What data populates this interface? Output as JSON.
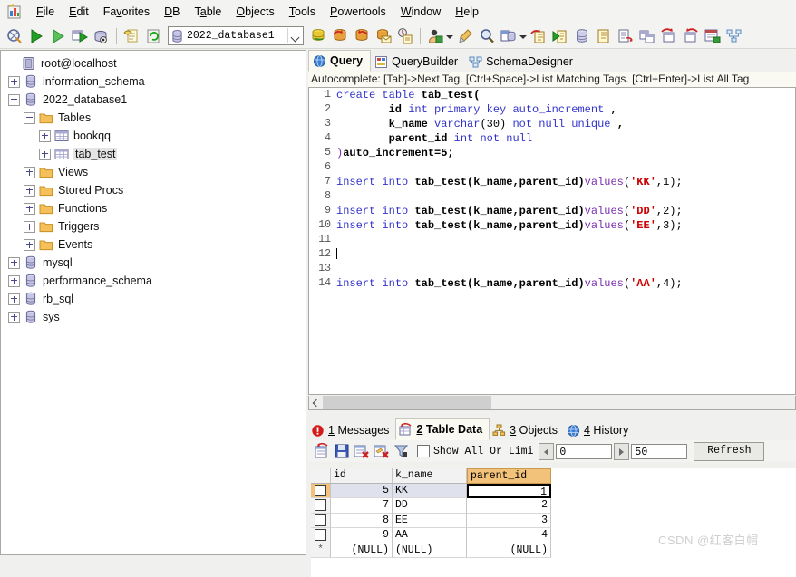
{
  "menubar": {
    "app_icon": "sqlyog-app-icon",
    "items": [
      {
        "label": "File",
        "accel": "F"
      },
      {
        "label": "Edit",
        "accel": "E"
      },
      {
        "label": "Favorites",
        "accel": "v"
      },
      {
        "label": "DB",
        "accel": "D"
      },
      {
        "label": "Table",
        "accel": "a"
      },
      {
        "label": "Objects",
        "accel": "O"
      },
      {
        "label": "Tools",
        "accel": "T"
      },
      {
        "label": "Powertools",
        "accel": "P"
      },
      {
        "label": "Window",
        "accel": "W"
      },
      {
        "label": "Help",
        "accel": "H"
      }
    ]
  },
  "toolbar": {
    "database_selector": {
      "value": "2022_database1",
      "icon": "database-icon"
    },
    "icons": [
      "new-connection-icon",
      "execute-query-icon",
      "execute-current-query-icon",
      "execute-query-to-grid-icon",
      "stop-query-icon",
      "open-file-icon",
      "refresh-icon",
      "import-external-data-icon",
      "restore-from-sql-dump-icon",
      "backup-database-icon",
      "export-as-email-icon",
      "schedule-backup-icon",
      "user-manager-icon",
      "flush-icon",
      "find-icon",
      "database-sync-icon",
      "copy-database-icon",
      "run-script-icon",
      "copy-table-icon",
      "paste-icon",
      "query-to-file-icon",
      "new-table-icon",
      "alter-table-icon",
      "truncate-table-icon",
      "table-diagnostics-icon",
      "schema-designer-icon"
    ]
  },
  "sidebar": {
    "nodes": [
      {
        "label": "root@localhost",
        "icon": "server-icon",
        "indent": 0,
        "toggle": "none",
        "selected": false
      },
      {
        "label": "information_schema",
        "icon": "database-icon",
        "indent": 0,
        "toggle": "plus",
        "selected": false
      },
      {
        "label": "2022_database1",
        "icon": "database-icon",
        "indent": 0,
        "toggle": "minus",
        "selected": false
      },
      {
        "label": "Tables",
        "icon": "folder-icon",
        "indent": 1,
        "toggle": "minus",
        "selected": false
      },
      {
        "label": "bookqq",
        "icon": "table-icon",
        "indent": 2,
        "toggle": "plus",
        "selected": false
      },
      {
        "label": "tab_test",
        "icon": "table-icon",
        "indent": 2,
        "toggle": "plus",
        "selected": true
      },
      {
        "label": "Views",
        "icon": "folder-icon",
        "indent": 1,
        "toggle": "plus",
        "selected": false
      },
      {
        "label": "Stored Procs",
        "icon": "folder-icon",
        "indent": 1,
        "toggle": "plus",
        "selected": false
      },
      {
        "label": "Functions",
        "icon": "folder-icon",
        "indent": 1,
        "toggle": "plus",
        "selected": false
      },
      {
        "label": "Triggers",
        "icon": "folder-icon",
        "indent": 1,
        "toggle": "plus",
        "selected": false
      },
      {
        "label": "Events",
        "icon": "folder-icon",
        "indent": 1,
        "toggle": "plus",
        "selected": false
      },
      {
        "label": "mysql",
        "icon": "database-icon",
        "indent": 0,
        "toggle": "plus",
        "selected": false
      },
      {
        "label": "performance_schema",
        "icon": "database-icon",
        "indent": 0,
        "toggle": "plus",
        "selected": false
      },
      {
        "label": "rb_sql",
        "icon": "database-icon",
        "indent": 0,
        "toggle": "plus",
        "selected": false
      },
      {
        "label": "sys",
        "icon": "database-icon",
        "indent": 0,
        "toggle": "plus",
        "selected": false
      }
    ]
  },
  "query_panel": {
    "tabs": [
      {
        "label": "Query",
        "icon": "query-globe-icon",
        "active": true
      },
      {
        "label": "QueryBuilder",
        "icon": "querybuilder-icon",
        "active": false
      },
      {
        "label": "SchemaDesigner",
        "icon": "schemadesigner-icon",
        "active": false
      }
    ],
    "autocomplete_hint": "Autocomplete: [Tab]->Next Tag. [Ctrl+Space]->List Matching Tags. [Ctrl+Enter]->List All Tag",
    "line_numbers": [
      "1",
      "2",
      "3",
      "4",
      "5",
      "6",
      "7",
      "8",
      "9",
      "10",
      "11",
      "12",
      "13",
      "14"
    ],
    "code_lines": [
      [
        {
          "t": "create ",
          "c": "k"
        },
        {
          "t": "table ",
          "c": "k"
        },
        {
          "t": "tab_test(",
          "c": "id"
        }
      ],
      [
        {
          "t": "        id ",
          "c": "id"
        },
        {
          "t": "int ",
          "c": "k"
        },
        {
          "t": "primary ",
          "c": "k"
        },
        {
          "t": "key ",
          "c": "k"
        },
        {
          "t": "auto_increment ",
          "c": "k"
        },
        {
          "t": ",",
          "c": "id"
        }
      ],
      [
        {
          "t": "        k_name ",
          "c": "id"
        },
        {
          "t": "varchar",
          "c": "k"
        },
        {
          "t": "(30) ",
          "c": "pl"
        },
        {
          "t": "not ",
          "c": "k"
        },
        {
          "t": "null ",
          "c": "k"
        },
        {
          "t": "unique ",
          "c": "k"
        },
        {
          "t": ",",
          "c": "id"
        }
      ],
      [
        {
          "t": "        parent_id ",
          "c": "id"
        },
        {
          "t": "int ",
          "c": "k"
        },
        {
          "t": "not ",
          "c": "k"
        },
        {
          "t": "null",
          "c": "k"
        }
      ],
      [
        {
          "t": ")",
          "c": "fn"
        },
        {
          "t": "auto_increment=5;",
          "c": "id"
        }
      ],
      [],
      [
        {
          "t": "insert ",
          "c": "k"
        },
        {
          "t": "into ",
          "c": "k"
        },
        {
          "t": "tab_test(k_name,parent_id)",
          "c": "id"
        },
        {
          "t": "values",
          "c": "fn"
        },
        {
          "t": "(",
          "c": "pl"
        },
        {
          "t": "'KK'",
          "c": "str"
        },
        {
          "t": ",1);",
          "c": "pl"
        }
      ],
      [],
      [
        {
          "t": "insert ",
          "c": "k"
        },
        {
          "t": "into ",
          "c": "k"
        },
        {
          "t": "tab_test(k_name,parent_id)",
          "c": "id"
        },
        {
          "t": "values",
          "c": "fn"
        },
        {
          "t": "(",
          "c": "pl"
        },
        {
          "t": "'DD'",
          "c": "str"
        },
        {
          "t": ",2);",
          "c": "pl"
        }
      ],
      [
        {
          "t": "insert ",
          "c": "k"
        },
        {
          "t": "into ",
          "c": "k"
        },
        {
          "t": "tab_test(k_name,parent_id)",
          "c": "id"
        },
        {
          "t": "values",
          "c": "fn"
        },
        {
          "t": "(",
          "c": "pl"
        },
        {
          "t": "'EE'",
          "c": "str"
        },
        {
          "t": ",3);",
          "c": "pl"
        }
      ],
      [],
      [],
      [],
      [
        {
          "t": "insert ",
          "c": "k"
        },
        {
          "t": "into ",
          "c": "k"
        },
        {
          "t": "tab_test(k_name,parent_id)",
          "c": "id"
        },
        {
          "t": "values",
          "c": "fn"
        },
        {
          "t": "(",
          "c": "pl"
        },
        {
          "t": "'AA'",
          "c": "str"
        },
        {
          "t": ",4);",
          "c": "pl"
        }
      ]
    ],
    "caret_line_index": 11
  },
  "results_panel": {
    "tabs": [
      {
        "num": "1",
        "label": "Messages",
        "icon": "messages-info-icon",
        "active": false
      },
      {
        "num": "2",
        "label": "Table Data",
        "icon": "table-data-icon",
        "active": true
      },
      {
        "num": "3",
        "label": "Objects",
        "icon": "objects-tree-icon",
        "active": false
      },
      {
        "num": "4",
        "label": "History",
        "icon": "history-globe-icon",
        "active": false
      }
    ],
    "toolbar": {
      "icons": [
        "view-data-icon",
        "save-changes-icon",
        "delete-row-icon",
        "discard-changes-icon",
        "filter-icon"
      ],
      "show_all_label": "Show All Or  Limi",
      "show_all_checked": false,
      "offset_value": "0",
      "limit_value": "50",
      "refresh_label": "Refresh"
    },
    "grid": {
      "columns": [
        "id",
        "k_name",
        "parent_id"
      ],
      "highlighted_column": "parent_id",
      "rows": [
        {
          "marker": "checkbox",
          "current": true,
          "id": "5",
          "k_name": "KK",
          "parent_id": "1"
        },
        {
          "marker": "checkbox",
          "current": false,
          "id": "7",
          "k_name": "DD",
          "parent_id": "2"
        },
        {
          "marker": "checkbox",
          "current": false,
          "id": "8",
          "k_name": "EE",
          "parent_id": "3"
        },
        {
          "marker": "checkbox",
          "current": false,
          "id": "9",
          "k_name": "AA",
          "parent_id": "4"
        },
        {
          "marker": "star",
          "current": false,
          "id": "(NULL)",
          "k_name": "(NULL)",
          "parent_id": "(NULL)"
        }
      ]
    }
  },
  "watermark": {
    "text": "CSDN @红客白帽"
  }
}
